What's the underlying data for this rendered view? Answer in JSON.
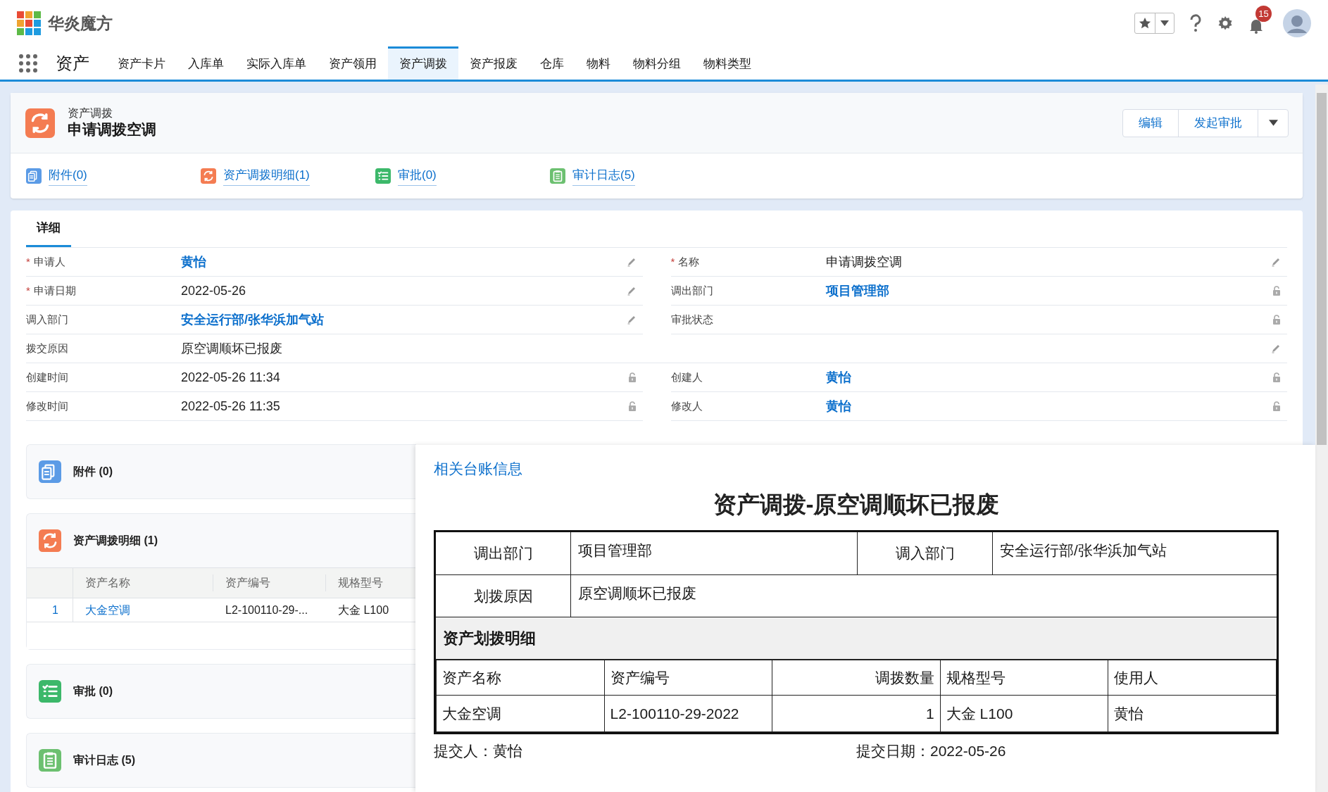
{
  "app": {
    "name": "华炎魔方",
    "notifications": "15"
  },
  "nav": {
    "title": "资产",
    "tabs": [
      {
        "label": "资产卡片",
        "selected": false
      },
      {
        "label": "入库单",
        "selected": false
      },
      {
        "label": "实际入库单",
        "selected": false
      },
      {
        "label": "资产领用",
        "selected": false
      },
      {
        "label": "资产调拨",
        "selected": true
      },
      {
        "label": "资产报废",
        "selected": false
      },
      {
        "label": "仓库",
        "selected": false
      },
      {
        "label": "物料",
        "selected": false
      },
      {
        "label": "物料分组",
        "selected": false
      },
      {
        "label": "物料类型",
        "selected": false
      }
    ]
  },
  "record": {
    "object": "资产调拨",
    "title": "申请调拨空调",
    "actions": [
      "编辑",
      "发起审批"
    ],
    "quick_links": [
      {
        "label": "附件(0)",
        "kind": "files"
      },
      {
        "label": "资产调拨明细(1)",
        "kind": "transfer"
      },
      {
        "label": "审批(0)",
        "kind": "approval"
      },
      {
        "label": "审计日志(5)",
        "kind": "log"
      }
    ]
  },
  "details": {
    "tab": "详细",
    "rows": [
      {
        "kind": "pair",
        "fields": [
          {
            "required_mark": "*",
            "label": "申请人",
            "value": "黄怡",
            "link": true,
            "editable": true
          },
          {
            "required_mark": "*",
            "label": "名称",
            "value": "申请调拨空调",
            "link": false,
            "editable": true
          }
        ]
      },
      {
        "kind": "pair",
        "fields": [
          {
            "required_mark": "*",
            "label": "申请日期",
            "value": "2022-05-26",
            "link": false,
            "editable": true
          },
          {
            "label": "调出部门",
            "value": "项目管理部",
            "link": true,
            "editable": false
          }
        ]
      },
      {
        "kind": "pair",
        "fields": [
          {
            "label": "调入部门",
            "value": "安全运行部/张华浜加气站",
            "link": true,
            "editable": true
          },
          {
            "label": "审批状态",
            "editable": false
          }
        ]
      },
      {
        "kind": "wide",
        "fields": [
          {
            "label": "拨交原因",
            "value": "原空调顺坏已报废",
            "link": false,
            "editable": true
          }
        ]
      },
      {
        "kind": "pair",
        "fields": [
          {
            "label": "创建时间",
            "value": "2022-05-26 11:34",
            "link": false,
            "editable": false
          },
          {
            "label": "创建人",
            "value": "黄怡",
            "link": true,
            "editable": false
          }
        ]
      },
      {
        "kind": "pair",
        "fields": [
          {
            "label": "修改时间",
            "value": "2022-05-26 11:35",
            "link": false,
            "editable": false
          },
          {
            "label": "修改人",
            "value": "黄怡",
            "link": true,
            "editable": false
          }
        ]
      }
    ]
  },
  "related": [
    {
      "title": "附件 (0)",
      "kind": "files"
    },
    {
      "title": "资产调拨明细 (1)",
      "kind": "transfer",
      "table": {
        "columns": [
          "资产名称",
          "资产编号",
          "规格型号"
        ],
        "rows": [
          {
            "index": "1",
            "cells": [
              "大金空调",
              "L2-100110-29-...",
              "大金 L100"
            ]
          }
        ]
      }
    },
    {
      "title": "审批 (0)",
      "kind": "approval"
    },
    {
      "title": "审计日志 (5)",
      "kind": "log"
    }
  ],
  "ledger": {
    "link": "相关台账信息",
    "title": "资产调拨-原空调顺坏已报废",
    "out_label": "调出部门",
    "out_value": "项目管理部",
    "in_label": "调入部门",
    "in_value": "安全运行部/张华浜加气站",
    "reason_label": "划拨原因",
    "reason_value": "原空调顺坏已报废",
    "section": "资产划拨明细",
    "columns": [
      {
        "label": "资产名称",
        "kind": "text"
      },
      {
        "label": "资产编号",
        "kind": "text"
      },
      {
        "label": "调拨数量",
        "kind": "number"
      },
      {
        "label": "规格型号",
        "kind": "text"
      },
      {
        "label": "使用人",
        "kind": "text"
      }
    ],
    "rows": [
      [
        "大金空调",
        "L2-100110-29-2022",
        "1",
        "大金 L100",
        "黄怡"
      ]
    ],
    "submitter": "提交人：黄怡",
    "date": "提交日期：2022-05-26"
  }
}
